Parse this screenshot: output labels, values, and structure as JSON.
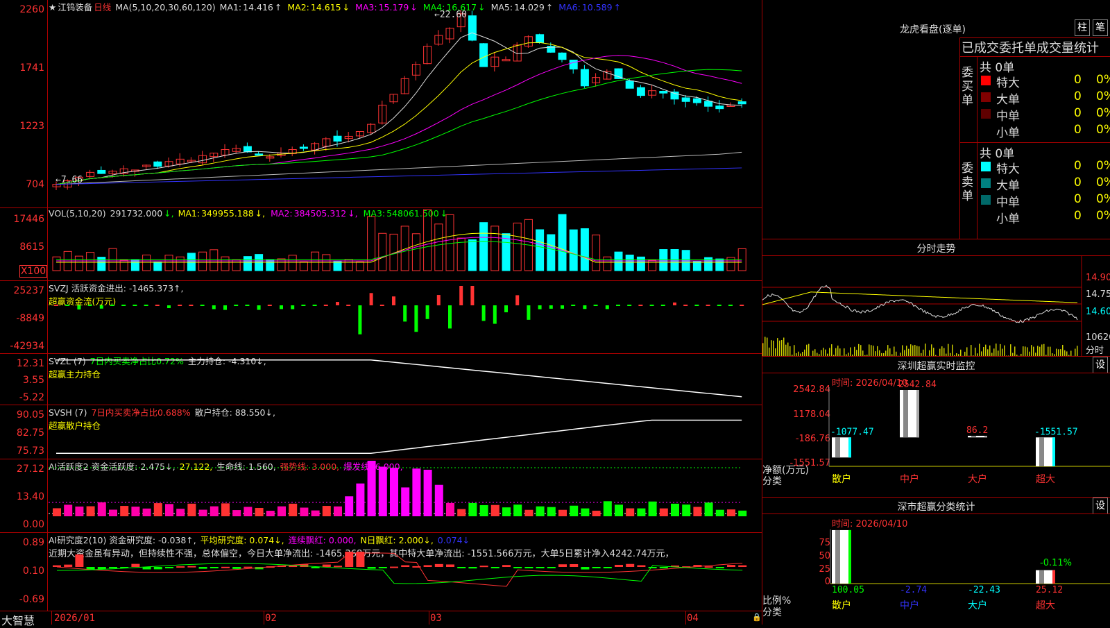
{
  "window": {
    "stock": "江钨装备",
    "period": "日线"
  },
  "k_panel": {
    "ma_params": "MA(5,10,20,30,60,120)",
    "ma": [
      {
        "label": "MA1:",
        "value": "14.416",
        "arrow": "↑",
        "color": "#dddddd"
      },
      {
        "label": "MA2:",
        "value": "14.615",
        "arrow": "↓",
        "color": "#ffff00"
      },
      {
        "label": "MA3:",
        "value": "15.179",
        "arrow": "↓",
        "color": "#ff00ff"
      },
      {
        "label": "MA4:",
        "value": "16.617",
        "arrow": "↓",
        "color": "#00ff00"
      },
      {
        "label": "MA5:",
        "value": "14.029",
        "arrow": "↑",
        "color": "#dddddd"
      },
      {
        "label": "MA6:",
        "value": "10.589",
        "arrow": "↑",
        "color": "#3333ff"
      }
    ],
    "axis": [
      "2260",
      "1741",
      "1223",
      "704"
    ],
    "high_label": "22.60",
    "low_label": "7.66"
  },
  "vol_panel": {
    "label": "VOL(5,10,20)",
    "value": "291732.000",
    "arrow1": "↓,",
    "ma": [
      {
        "label": "MA1:",
        "value": "349955.188",
        "arrow": "↓,",
        "color": "#ffff00"
      },
      {
        "label": "MA2:",
        "value": "384505.312",
        "arrow": "↓,",
        "color": "#ff00ff"
      },
      {
        "label": "MA3:",
        "value": "548061.500",
        "arrow": "↓",
        "color": "#00ff00"
      }
    ],
    "axis": [
      "17446",
      "8615",
      "X100"
    ]
  },
  "svzj_panel": {
    "line1": "SVZJ  活跃资金进出: -1465.373↑,",
    "line2": "超赢资金流(万元)",
    "axis": [
      "25237",
      "-8849",
      "-42934"
    ]
  },
  "svzl_panel": {
    "p1": "SVZL (7) ",
    "p2": "7日内买卖净占比0.72%",
    "p3": " 主力持仓: -4.310↓,",
    "line2": "超赢主力持仓",
    "axis": [
      "12.31",
      "3.55",
      "-5.22"
    ]
  },
  "svsh_panel": {
    "p1": "SVSH (7) ",
    "p2": "7日内买卖净占比0.688%",
    "p3": " 散户持仓: 88.550↓,",
    "line2": "超赢散户持仓",
    "axis": [
      "90.05",
      "82.75",
      "75.73"
    ]
  },
  "ai1_panel": {
    "p1": "AI活跃度2 资金活跃度: 2.475↓,",
    "p2": " 27.122,",
    "p3": " 生命线: 1.560,",
    "p4": " 强势线: 3.000,",
    "p5": " 爆发线: 6.000,",
    "axis": [
      "27.12",
      "13.40",
      "0.00"
    ]
  },
  "ai2_panel": {
    "p1": "AI研究度2(10) 资金研究度: -0.038↑,",
    "p2": " 平均研究度: 0.074↓,",
    "p3": " 连续飘红: 0.000,",
    "p4": " N日飘红: 2.000↓,",
    "p5": " 0.074↓",
    "comment": "近期大资金虽有异动，但持续性不强，总体偏空，今日大单净流出: -1465.368万元，其中特大单净流出: -1551.566万元，大单5日累计净入4242.74万元，",
    "axis": [
      "0.89",
      "0.10",
      "-0.69"
    ]
  },
  "x_axis": {
    "brand": "大智慧",
    "labels": [
      "2026/01",
      "02",
      "03",
      "04"
    ]
  },
  "longhu": {
    "title": "龙虎看盘(逐单)",
    "btn1": "柱",
    "btn2": "笔",
    "header": "已成交委托单成交量统计",
    "buy_group": "委买单",
    "sell_group": "委卖单",
    "buy_total": "共 0单",
    "sell_total": "共 0单",
    "buy_rows": [
      {
        "label": "特大",
        "count": "0",
        "pct": "0%",
        "color": "#ff0000"
      },
      {
        "label": "大单",
        "count": "0",
        "pct": "0%",
        "color": "#800000"
      },
      {
        "label": "中单",
        "count": "0",
        "pct": "0%",
        "color": "#600000"
      },
      {
        "label": "小单",
        "count": "0",
        "pct": "0%",
        "color": "#000000"
      }
    ],
    "sell_rows": [
      {
        "label": "特大",
        "count": "0",
        "pct": "0%",
        "color": "#00ffff"
      },
      {
        "label": "大单",
        "count": "0",
        "pct": "0%",
        "color": "#008080"
      },
      {
        "label": "中单",
        "count": "0",
        "pct": "0%",
        "color": "#006868"
      },
      {
        "label": "小单",
        "count": "0",
        "pct": "0%",
        "color": "#000000"
      }
    ]
  },
  "intraday": {
    "title": "分时走势",
    "axis": [
      "14.90",
      "14.75",
      "14.60"
    ],
    "vol_axis": "10626",
    "vol_label": "分时"
  },
  "sz_monitor": {
    "title": "深圳超赢实时监控",
    "btn": "设",
    "time": "时间: 2026/04/10",
    "axis": [
      "2542.84",
      "1178.04",
      "-186.76",
      "-1551.57"
    ],
    "y_label": "净额(万元)",
    "x_label": "分类",
    "bars": [
      {
        "label": "散户",
        "value": "-1077.47",
        "vcolor": "#00ffff",
        "lcolor": "#ffff00"
      },
      {
        "label": "中户",
        "value": "2542.84",
        "vcolor": "#ff3333",
        "lcolor": "#ff3333"
      },
      {
        "label": "大户",
        "value": "86.2",
        "vcolor": "#ff3333",
        "lcolor": "#ff3333"
      },
      {
        "label": "超大",
        "value": "-1551.57",
        "vcolor": "#00ffff",
        "lcolor": "#ff3333"
      }
    ]
  },
  "sz_stats": {
    "title": "深市超赢分类统计",
    "btn": "设",
    "time": "时间: 2026/04/10",
    "axis": [
      "75",
      "50",
      "25",
      "0"
    ],
    "y_label": "比例%",
    "x_label": "分类",
    "extra": "-0.11%",
    "bars": [
      {
        "label": "散户",
        "value": "100.05",
        "vcolor": "#00ff00",
        "lcolor": "#ffff00"
      },
      {
        "label": "中户",
        "value": "-2.74",
        "vcolor": "#3333ff",
        "lcolor": "#3333ff"
      },
      {
        "label": "大户",
        "value": "-22.43",
        "vcolor": "#00ffff",
        "lcolor": "#00ffff"
      },
      {
        "label": "超大",
        "value": "25.12",
        "vcolor": "#ff3333",
        "lcolor": "#ff3333"
      }
    ]
  },
  "colors": {
    "up": "#ff3333",
    "down": "#00ffff",
    "grid": "#aa0000"
  }
}
